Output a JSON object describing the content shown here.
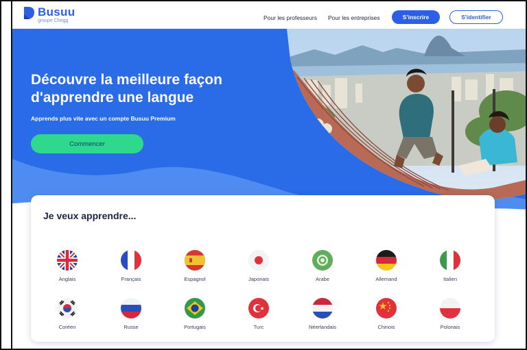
{
  "header": {
    "logo_name": "Busuu",
    "logo_sub": "groupe Chegg",
    "nav_teachers": "Pour les professeurs",
    "nav_business": "Pour les entreprises",
    "signup": "S'inscrire",
    "login": "S'identifier"
  },
  "hero": {
    "title_line1": "Découvre la meilleure façon",
    "title_line2": "d'apprendre une langue",
    "subtitle": "Apprends plus vite avec un compte Busuu Premium",
    "cta": "Commencer"
  },
  "languages": {
    "title": "Je veux apprendre...",
    "items": [
      {
        "label": "Anglais",
        "icon": "uk-flag-icon"
      },
      {
        "label": "Français",
        "icon": "france-flag-icon"
      },
      {
        "label": "Espagnol",
        "icon": "spain-flag-icon"
      },
      {
        "label": "Japonais",
        "icon": "japan-flag-icon"
      },
      {
        "label": "Arabe",
        "icon": "arabic-emblem-icon"
      },
      {
        "label": "Allemand",
        "icon": "germany-flag-icon"
      },
      {
        "label": "Italien",
        "icon": "italy-flag-icon"
      },
      {
        "label": "Coréen",
        "icon": "korea-flag-icon"
      },
      {
        "label": "Russe",
        "icon": "russia-flag-icon"
      },
      {
        "label": "Portugais",
        "icon": "brazil-flag-icon"
      },
      {
        "label": "Turc",
        "icon": "turkey-flag-icon"
      },
      {
        "label": "Néerlandais",
        "icon": "netherlands-flag-icon"
      },
      {
        "label": "Chinois",
        "icon": "china-flag-icon"
      },
      {
        "label": "Polonais",
        "icon": "poland-flag-icon"
      }
    ]
  },
  "colors": {
    "brand_blue": "#2c5ee8",
    "cta_green": "#2ed98d"
  }
}
